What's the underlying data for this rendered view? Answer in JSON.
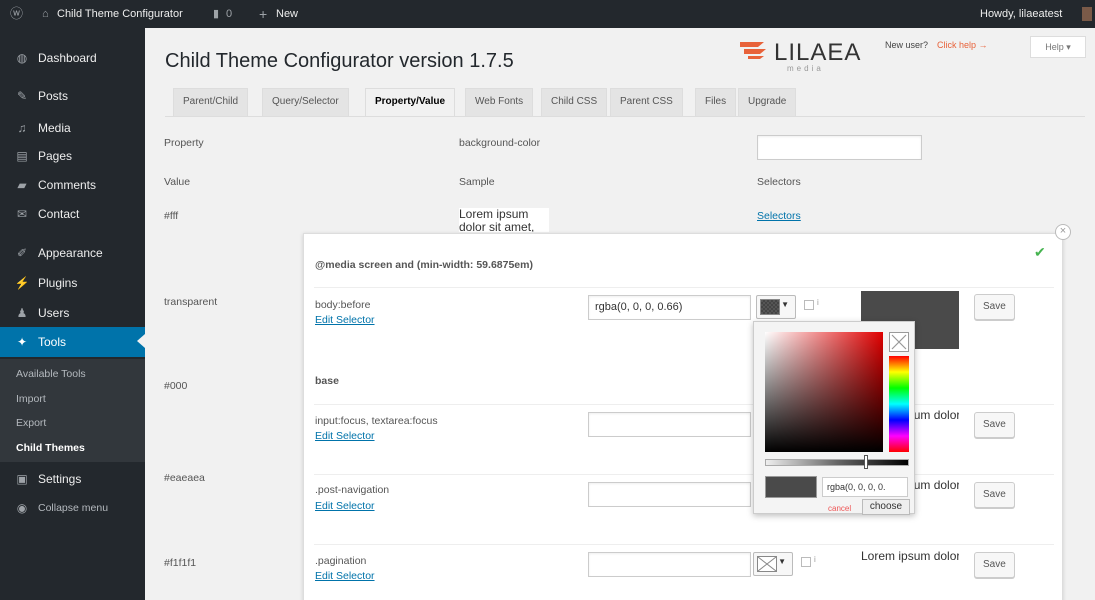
{
  "adminbar": {
    "site_name": "Child Theme Configurator",
    "comment_count": "0",
    "new_label": "New",
    "greeting": "Howdy, lilaeatest"
  },
  "sidebar": {
    "items": [
      {
        "label": "Dashboard",
        "icon": "dashboard-icon"
      },
      {
        "label": "Posts",
        "icon": "pin-icon"
      },
      {
        "label": "Media",
        "icon": "media-icon"
      },
      {
        "label": "Pages",
        "icon": "page-icon"
      },
      {
        "label": "Comments",
        "icon": "comment-icon"
      },
      {
        "label": "Contact",
        "icon": "mail-icon"
      },
      {
        "label": "Appearance",
        "icon": "brush-icon"
      },
      {
        "label": "Plugins",
        "icon": "plug-icon"
      },
      {
        "label": "Users",
        "icon": "user-icon"
      },
      {
        "label": "Tools",
        "icon": "wrench-icon"
      },
      {
        "label": "Settings",
        "icon": "settings-icon"
      },
      {
        "label": "Collapse menu",
        "icon": "collapse-icon"
      }
    ],
    "tools_sub": [
      "Available Tools",
      "Import",
      "Export",
      "Child Themes"
    ]
  },
  "page": {
    "title": "Child Theme Configurator version 1.7.5",
    "logo_main": "LILAEA",
    "logo_sub": "media",
    "new_user_text": "New user?",
    "click_help": "Click help →",
    "help_button": "Help ▾"
  },
  "tabs": [
    "Parent/Child",
    "Query/Selector",
    "Property/Value",
    "Web Fonts",
    "Child CSS",
    "Parent CSS",
    "Files",
    "Upgrade"
  ],
  "prop": {
    "property_label": "Property",
    "property_value": "background-color",
    "value_header": "Value",
    "sample_header": "Sample",
    "selectors_header": "Selectors",
    "selectors_link": "Selectors"
  },
  "values": [
    "#fff",
    "transparent",
    "#000",
    "#eaeaea",
    "#f1f1f1"
  ],
  "sample_text": "Lorem ipsum dolor sit amet, consectetur adipiscing elit.",
  "panel": {
    "media_heading": "@media screen and (min-width: 59.6875em)",
    "base_heading": "base",
    "edit_selector": "Edit Selector",
    "save": "Save",
    "rows": [
      {
        "selector": "body:before",
        "value": "rgba(0, 0, 0, 0.66)"
      },
      {
        "selector": "input:focus, textarea:focus",
        "value": ""
      },
      {
        "selector": ".post-navigation",
        "value": ""
      },
      {
        "selector": ".pagination",
        "value": ""
      }
    ],
    "checkbox_label": "i"
  },
  "colorpicker": {
    "preview_value": "rgba(0, 0, 0, 0.",
    "cancel": "cancel",
    "choose": "choose"
  },
  "colors": {
    "accent": "#0073aa",
    "admin_bg": "#23282d",
    "logo_orange": "#e8623a",
    "success": "#46b450"
  }
}
